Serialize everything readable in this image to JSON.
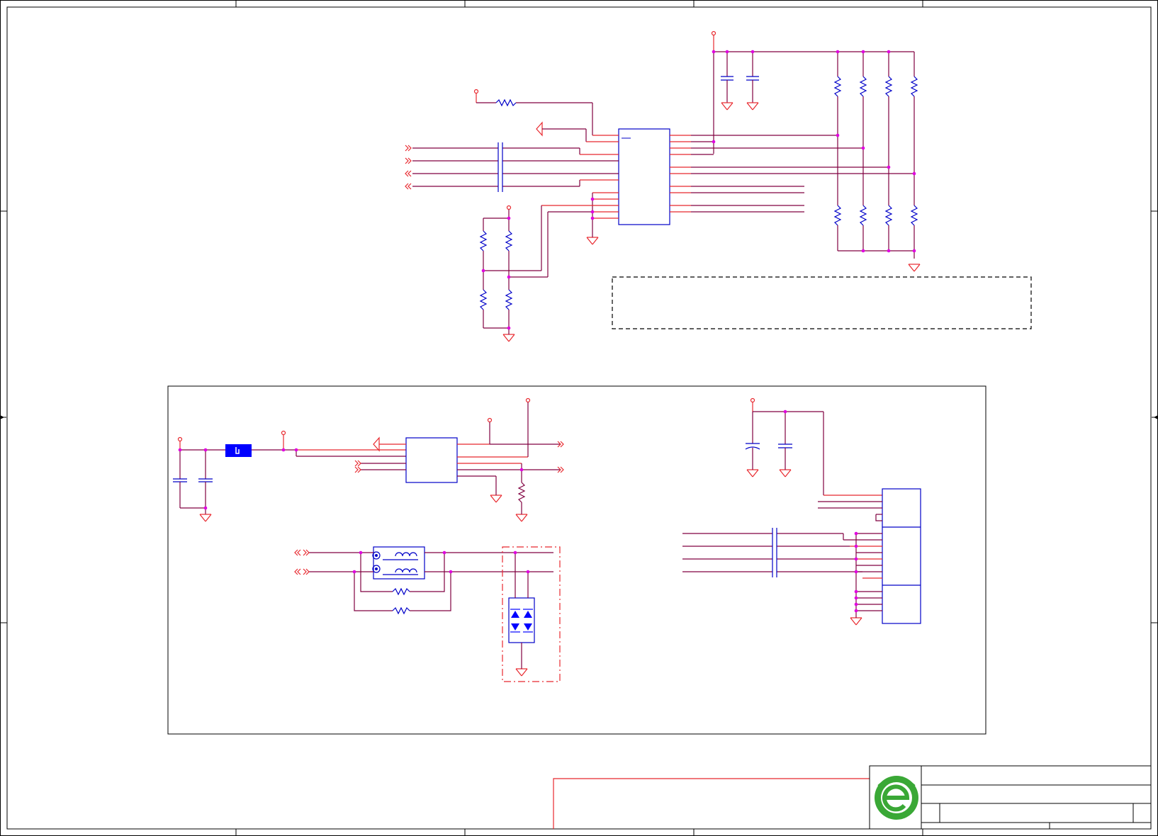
{
  "sheet": {
    "type": "schematic-sheet",
    "title_block": {
      "logo": "green-e-logo",
      "fields": []
    }
  },
  "colors": {
    "frame": "#000000",
    "wire_red": "#e8282e",
    "wire_maroon": "#800040",
    "component_blue": "#0000c8",
    "junction": "#e000e0",
    "fill_blue": "#0000ff",
    "logo_green": "#3aa836"
  },
  "icons": [
    "ground-symbol",
    "power-port",
    "resistor",
    "capacitor",
    "off-page-connector",
    "transformer",
    "tvs-diode-array",
    "inductor",
    "junction-dot"
  ]
}
